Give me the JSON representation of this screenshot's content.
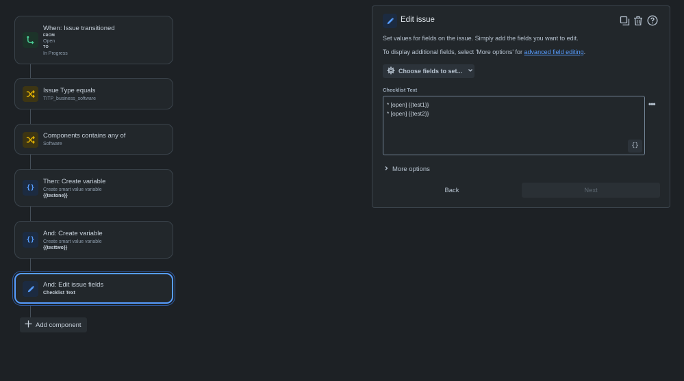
{
  "rule": {
    "trigger": {
      "title": "When: Issue transitioned",
      "from_label": "FROM",
      "from_value": "Open",
      "to_label": "TO",
      "to_value": "In Progress"
    },
    "condition1": {
      "title": "Issue Type equals",
      "subtitle": "TITP_business_software"
    },
    "condition2": {
      "title": "Components contains any of",
      "subtitle": "Software"
    },
    "action1": {
      "title": "Then: Create variable",
      "subtitle": "Create smart value variable",
      "variable": "{{testone}}"
    },
    "action2": {
      "title": "And: Create variable",
      "subtitle": "Create smart value variable",
      "variable": "{{testtwo}}"
    },
    "action3": {
      "title": "And: Edit issue fields",
      "field": "Checklist Text"
    },
    "add_component_label": "Add component"
  },
  "panel": {
    "title": "Edit issue",
    "description": "Set values for fields on the issue. Simply add the fields you want to edit.",
    "additional_prefix": "To display additional fields, select 'More options' for ",
    "additional_link": "advanced field editing",
    "additional_suffix": ".",
    "choose_fields_label": "Choose fields to set...",
    "field_label": "Checklist Text",
    "field_line1": "* [open] {{test1}}",
    "field_line2": "* [open] {{test2}}",
    "smart_values_label": "{}",
    "more_dots": "•••",
    "more_options_label": "More options",
    "back_label": "Back",
    "next_label": "Next"
  },
  "icons": {
    "trigger": "transition-icon",
    "condition": "shuffle-icon",
    "action": "braces-icon",
    "edit": "pencil-icon",
    "duplicate": "duplicate-icon",
    "delete": "trash-icon",
    "help": "help-icon"
  },
  "colors": {
    "background": "#1d2125",
    "card": "#22272b",
    "trigger_icon": "#4bce97",
    "condition_icon": "#e2b203",
    "action_icon": "#579dff",
    "link": "#579dff",
    "selected_border": "#579dff"
  }
}
